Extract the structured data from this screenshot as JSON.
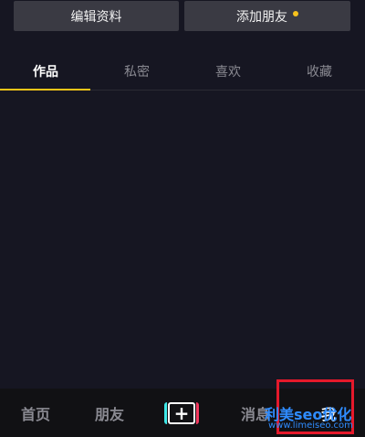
{
  "header": {
    "edit_profile_label": "编辑资料",
    "add_friends_label": "添加朋友",
    "add_friends_badge_color": "#f7c21c"
  },
  "tabs": [
    {
      "label": "作品",
      "active": true
    },
    {
      "label": "私密",
      "active": false
    },
    {
      "label": "喜欢",
      "active": false
    },
    {
      "label": "收藏",
      "active": false
    }
  ],
  "tab_indicator_color": "#f5c518",
  "bottom_nav": {
    "home": "首页",
    "friends": "朋友",
    "plus_icon": "+",
    "messages": "消息",
    "me": "我"
  },
  "watermark": {
    "title": "利美seo优化",
    "url": "www.limeiseo.com"
  },
  "colors": {
    "background": "#161622",
    "bottom_bar": "#111114",
    "highlight": "#e5192b",
    "watermark": "#2f8cff"
  }
}
